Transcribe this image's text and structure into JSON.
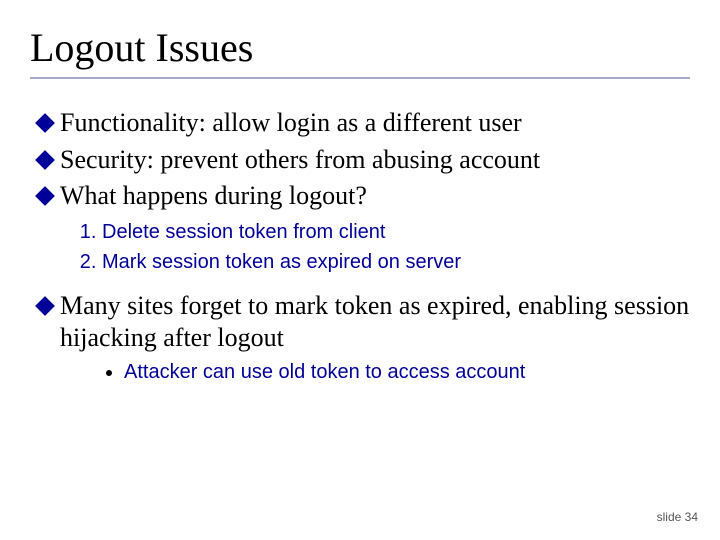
{
  "title": "Logout Issues",
  "bullets": {
    "b1": "Functionality: allow login as a different user",
    "b2": "Security: prevent others from abusing account",
    "b3": "What happens during logout?",
    "b4": "Many sites forget to mark token as expired, enabling session hijacking after logout"
  },
  "steps": {
    "s1": "Delete session token from client",
    "s2": "Mark session token as expired on server"
  },
  "subpoint": "Attacker can use old token to access account",
  "footer": "slide 34"
}
